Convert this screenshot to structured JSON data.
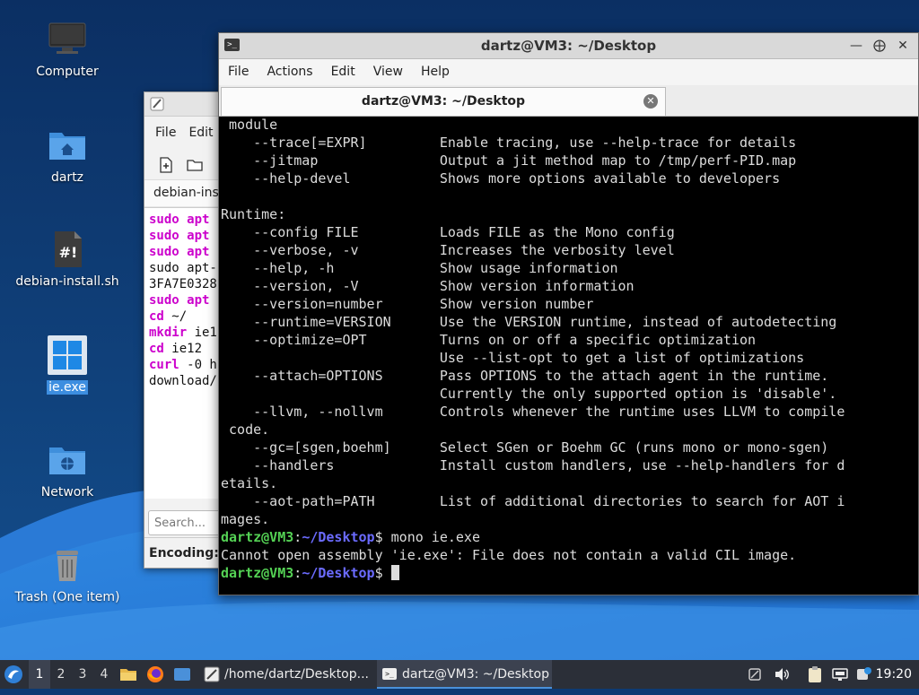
{
  "desktop": {
    "icons": [
      {
        "label": "Computer",
        "icon": "computer-icon"
      },
      {
        "label": "dartz",
        "icon": "home-folder-icon"
      },
      {
        "label": "debian-install.sh",
        "icon": "script-file-icon"
      },
      {
        "label": "ie.exe",
        "icon": "windows-exe-icon",
        "selected": true
      },
      {
        "label": "Network",
        "icon": "network-folder-icon"
      },
      {
        "label": "Trash (One item)",
        "icon": "trash-icon"
      }
    ]
  },
  "editor": {
    "menu": [
      "File",
      "Edit"
    ],
    "tab_label": "debian-ins",
    "lines": [
      {
        "kw": "sudo apt",
        "rest": ""
      },
      {
        "kw": "sudo apt",
        "rest": ""
      },
      {
        "kw": "sudo apt",
        "rest": ""
      },
      {
        "kw": "",
        "rest": "sudo apt-"
      },
      {
        "kw": "",
        "rest": "3FA7E0328"
      },
      {
        "kw": "sudo apt",
        "rest": ""
      },
      {
        "kw": "cd",
        "rest": " ~/"
      },
      {
        "kw": "mkdir",
        "rest": " ie1"
      },
      {
        "kw": "cd",
        "rest": " ie12"
      },
      {
        "kw": "curl",
        "rest": " -0 h"
      },
      {
        "kw": "",
        "rest": "download/"
      }
    ],
    "search_placeholder": "Search...",
    "status": "Encoding: "
  },
  "terminal": {
    "title": "dartz@VM3: ~/Desktop",
    "menu": [
      "File",
      "Actions",
      "Edit",
      "View",
      "Help"
    ],
    "tab_label": "dartz@VM3: ~/Desktop",
    "output_lines": [
      " module",
      "    --trace[=EXPR]         Enable tracing, use --help-trace for details",
      "    --jitmap               Output a jit method map to /tmp/perf-PID.map",
      "    --help-devel           Shows more options available to developers",
      "",
      "Runtime:",
      "    --config FILE          Loads FILE as the Mono config",
      "    --verbose, -v          Increases the verbosity level",
      "    --help, -h             Show usage information",
      "    --version, -V          Show version information",
      "    --version=number       Show version number",
      "    --runtime=VERSION      Use the VERSION runtime, instead of autodetecting",
      "    --optimize=OPT         Turns on or off a specific optimization",
      "                           Use --list-opt to get a list of optimizations",
      "    --attach=OPTIONS       Pass OPTIONS to the attach agent in the runtime.",
      "                           Currently the only supported option is 'disable'.",
      "    --llvm, --nollvm       Controls whenever the runtime uses LLVM to compile",
      " code.",
      "    --gc=[sgen,boehm]      Select SGen or Boehm GC (runs mono or mono-sgen)",
      "    --handlers             Install custom handlers, use --help-handlers for d",
      "etails.",
      "    --aot-path=PATH        List of additional directories to search for AOT i",
      "mages."
    ],
    "prompt_user": "dartz@VM3",
    "prompt_sep": ":",
    "prompt_path": "~/Desktop",
    "prompt_end": "$ ",
    "command1": "mono ie.exe",
    "error_line": "Cannot open assembly 'ie.exe': File does not contain a valid CIL image."
  },
  "taskbar": {
    "workspaces": [
      "1",
      "2",
      "3",
      "4"
    ],
    "tasks": [
      {
        "label": "/home/dartz/Desktop...",
        "icon": "text-editor-icon"
      },
      {
        "label": "dartz@VM3: ~/Desktop",
        "icon": "terminal-icon",
        "active": true
      }
    ],
    "clock": "19:20"
  },
  "colors": {
    "desktop_bg": "#0d3a73",
    "accent": "#3d8ee0",
    "prompt_user": "#54d154",
    "prompt_path": "#6b6bff",
    "script_keyword": "#cc00cc"
  }
}
